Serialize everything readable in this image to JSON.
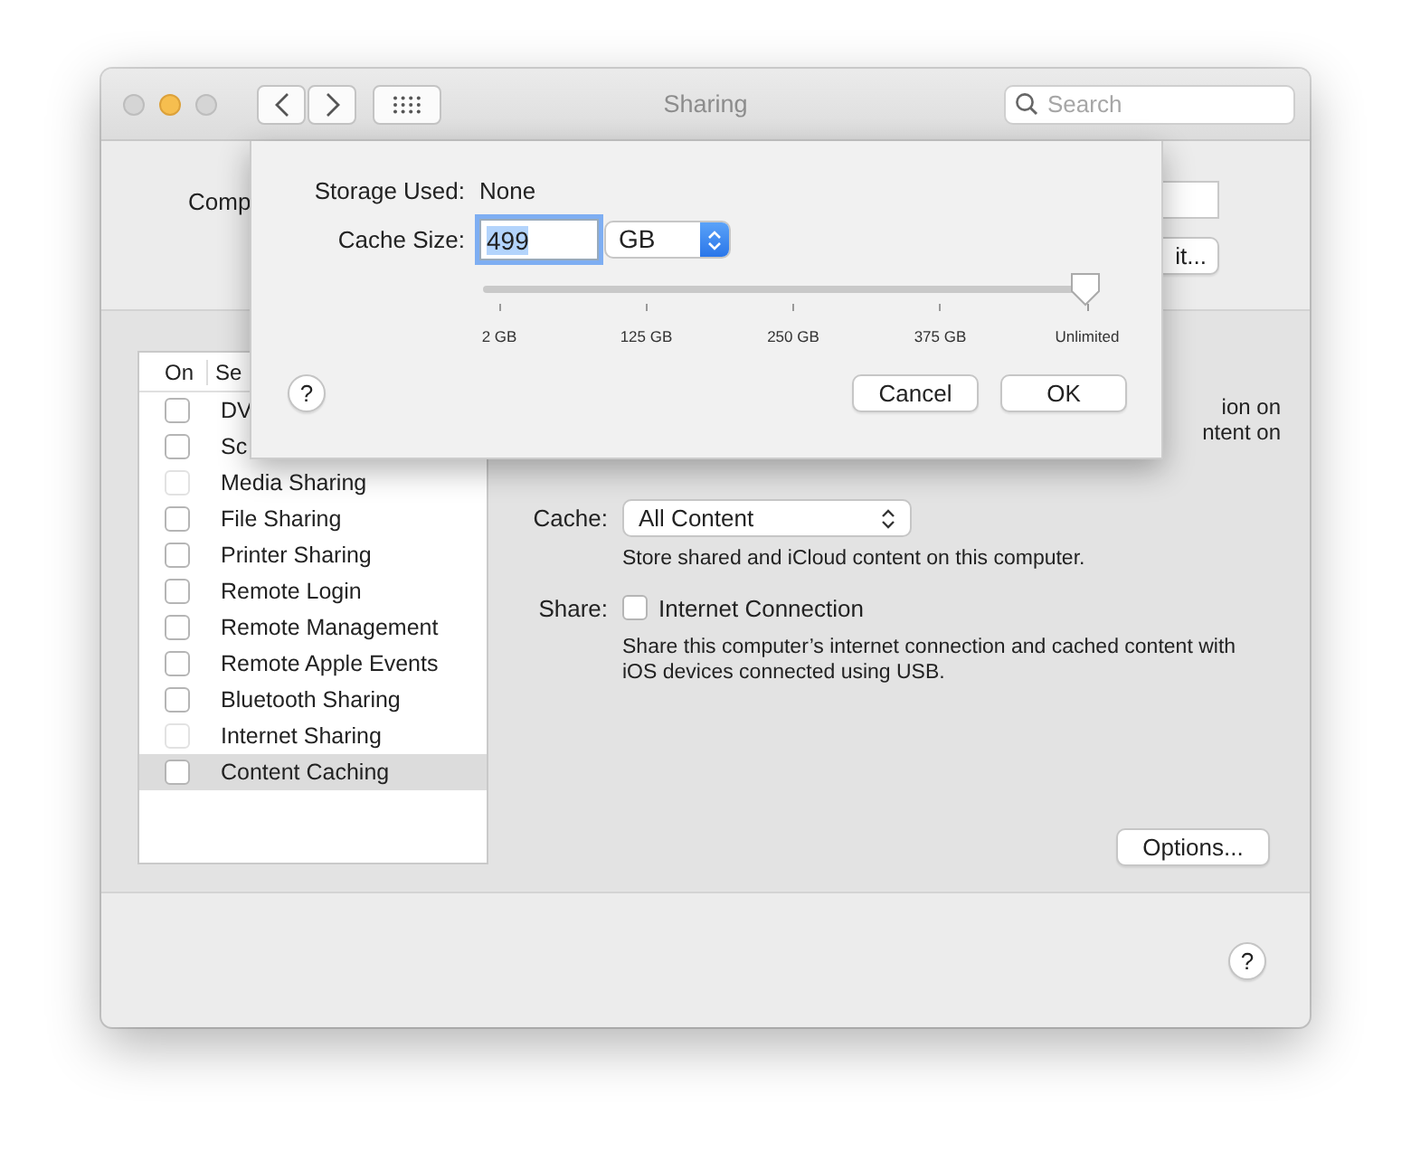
{
  "window": {
    "title": "Sharing",
    "search": {
      "placeholder": "Search"
    }
  },
  "computer_name": {
    "label": "Comp",
    "edit_button": "it..."
  },
  "services": {
    "columns": [
      "On",
      "Se"
    ],
    "rows": [
      {
        "name": "DV",
        "checked": false,
        "disabled": false,
        "selected": false
      },
      {
        "name": "Sc",
        "checked": false,
        "disabled": false,
        "selected": false
      },
      {
        "name": "Media Sharing",
        "checked": false,
        "disabled": true,
        "selected": false
      },
      {
        "name": "File Sharing",
        "checked": false,
        "disabled": false,
        "selected": false
      },
      {
        "name": "Printer Sharing",
        "checked": false,
        "disabled": false,
        "selected": false
      },
      {
        "name": "Remote Login",
        "checked": false,
        "disabled": false,
        "selected": false
      },
      {
        "name": "Remote Management",
        "checked": false,
        "disabled": false,
        "selected": false
      },
      {
        "name": "Remote Apple Events",
        "checked": false,
        "disabled": false,
        "selected": false
      },
      {
        "name": "Bluetooth Sharing",
        "checked": false,
        "disabled": false,
        "selected": false
      },
      {
        "name": "Internet Sharing",
        "checked": false,
        "disabled": true,
        "selected": false
      },
      {
        "name": "Content Caching",
        "checked": false,
        "disabled": false,
        "selected": true
      }
    ]
  },
  "detail": {
    "partial_lines": [
      "ion on",
      "ntent on"
    ],
    "cache": {
      "label": "Cache:",
      "value": "All Content",
      "note": "Store shared and iCloud content on this computer."
    },
    "share": {
      "label": "Share:",
      "option": "Internet Connection",
      "checked": false,
      "note": "Share this computer’s internet connection and cached content with iOS devices connected using USB."
    },
    "options_button": "Options...",
    "help": "?"
  },
  "sheet": {
    "storage_used": {
      "label": "Storage Used:",
      "value": "None"
    },
    "cache_size": {
      "label": "Cache Size:",
      "value": "499",
      "text_selected": true,
      "unit": "GB"
    },
    "slider": {
      "level": 1,
      "ticks": [
        "2 GB",
        "125 GB",
        "250 GB",
        "375 GB",
        "Unlimited"
      ]
    },
    "help": "?",
    "buttons": [
      "Cancel",
      "OK"
    ]
  }
}
